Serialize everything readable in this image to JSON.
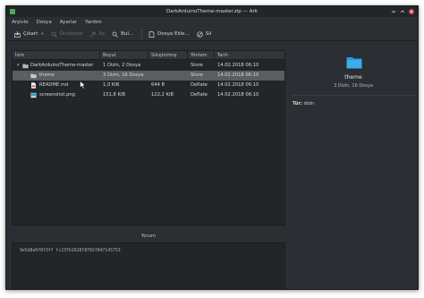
{
  "window": {
    "title": "DarkArduinoTheme-master.zip — Ark"
  },
  "menu": {
    "items": [
      "Arşivle",
      "Dosya",
      "Ayarlar",
      "Yardım"
    ]
  },
  "toolbar": {
    "extract_label": "Çıkart",
    "preview_label": "Önizleme",
    "open_label": "Aç",
    "search_label": "Bul...",
    "add_file_label": "Dosya Ekle...",
    "delete_label": "Sil"
  },
  "columns": {
    "name": "İsim",
    "size": "Boyut",
    "compressed": "Sıkıştırılmış",
    "method": "Yöntem",
    "date": "Tarih"
  },
  "rows": [
    {
      "name": "DarkArduinoTheme-master",
      "size": "1 Dizin, 2 Dosya",
      "compressed": "",
      "method": "Store",
      "date": "14.02.2018 06:10"
    },
    {
      "name": "theme",
      "size": "3 Dizin, 16 Dosya",
      "compressed": "",
      "method": "Store",
      "date": "14.02.2018 06:10"
    },
    {
      "name": "README.md",
      "size": "1,0 KiB",
      "compressed": "644 B",
      "method": "Deflate",
      "date": "14.02.2018 06:10"
    },
    {
      "name": "screenshot.png",
      "size": "151,8 KiB",
      "compressed": "122,2 KiB",
      "method": "Deflate",
      "date": "14.02.2018 06:10"
    }
  ],
  "info": {
    "name": "theme",
    "summary": "3 Dizin, 16 Dosya",
    "type_label": "Tür:",
    "type_value": "dizin"
  },
  "comment": {
    "label": "Yorum",
    "text": "9e5d8e6f8f3ff fc237b1028f8702f047145753"
  },
  "colors": {
    "selection": "#5b5e61",
    "folder": "#1d99f3",
    "background": "#2b2e33"
  }
}
